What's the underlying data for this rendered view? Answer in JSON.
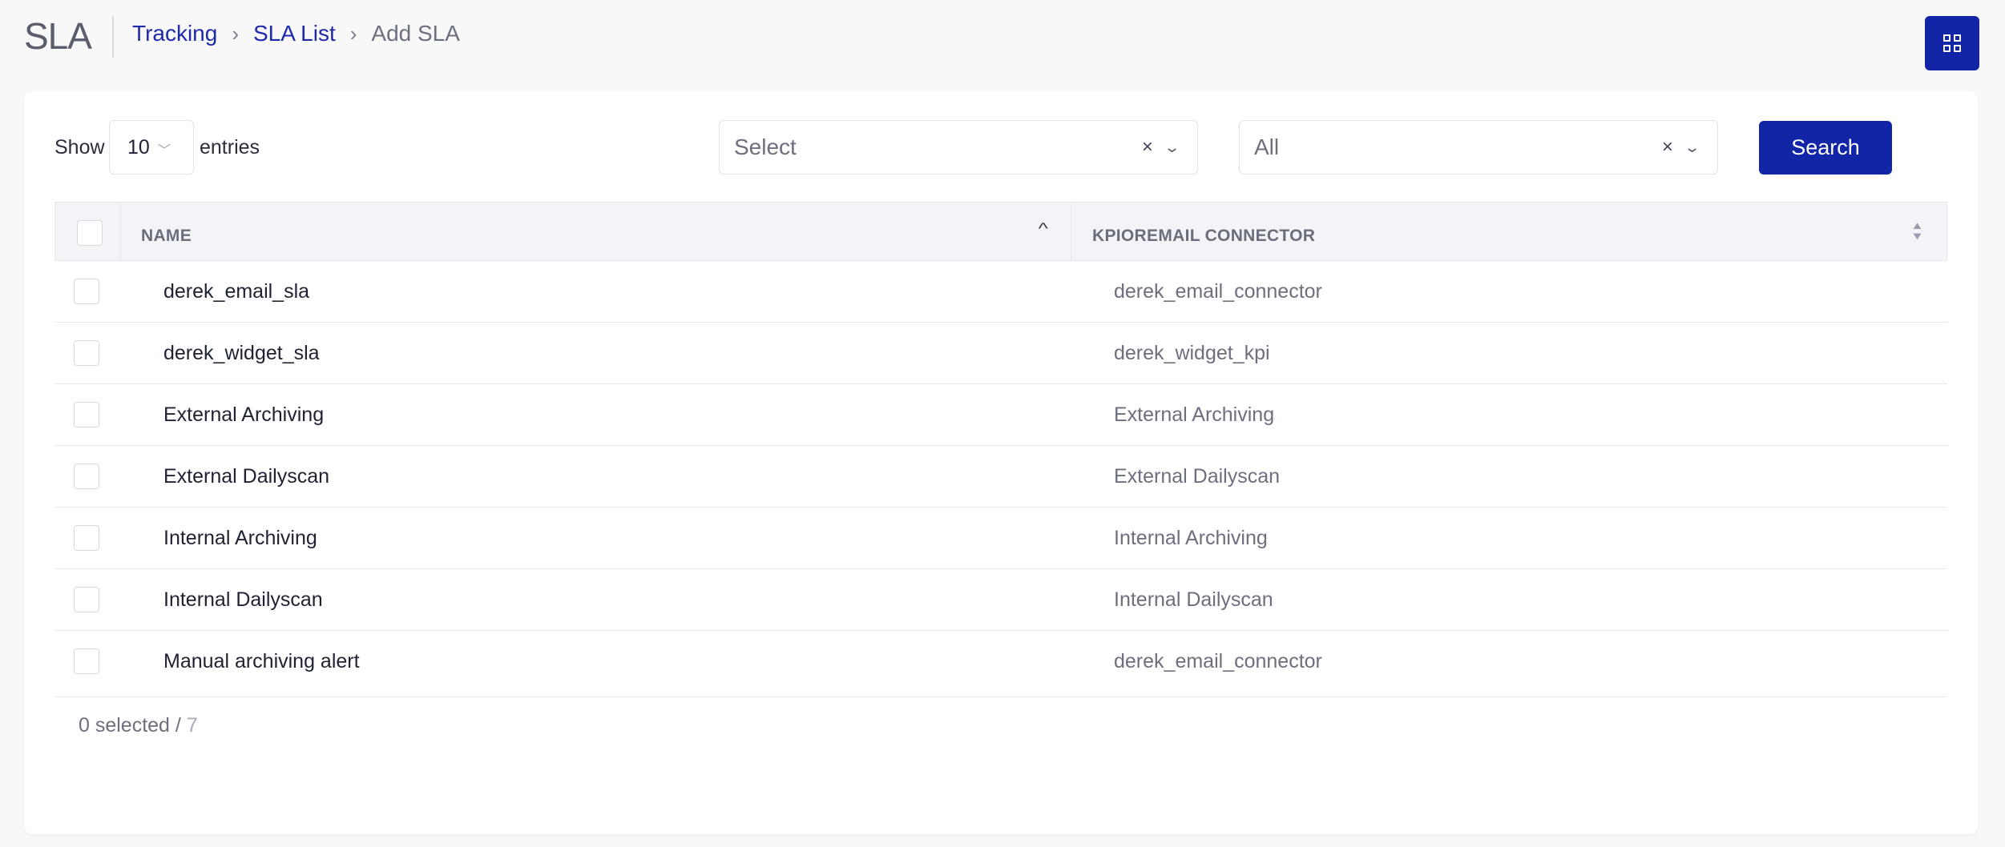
{
  "header": {
    "app_title": "SLA",
    "breadcrumb": [
      {
        "label": "Tracking"
      },
      {
        "label": "SLA List"
      },
      {
        "label": "Add SLA"
      }
    ],
    "apps_icon": "grid-icon"
  },
  "toolbar": {
    "show_label": "Show",
    "entries_value": "10",
    "entries_label": "entries",
    "filter_1": {
      "value": "Select",
      "clear": "×"
    },
    "filter_2": {
      "value": "All",
      "clear": "×"
    },
    "search_label": "Search"
  },
  "table": {
    "columns": {
      "name": "NAME",
      "kpi": "KPIOREMAIL CONNECTOR"
    },
    "rows": [
      {
        "name": "derek_email_sla",
        "kpi": "derek_email_connector"
      },
      {
        "name": "derek_widget_sla",
        "kpi": "derek_widget_kpi"
      },
      {
        "name": "External Archiving",
        "kpi": "External Archiving"
      },
      {
        "name": "External Dailyscan",
        "kpi": "External Dailyscan"
      },
      {
        "name": "Internal Archiving",
        "kpi": "Internal Archiving"
      },
      {
        "name": "Internal Dailyscan",
        "kpi": "Internal Dailyscan"
      },
      {
        "name": "Manual archiving alert",
        "kpi": "derek_email_connector"
      }
    ]
  },
  "footer": {
    "selected": "0 selected / ",
    "total": "7"
  },
  "colors": {
    "primary": "#1225a6",
    "link": "#1e2aa8",
    "background": "#f8f8f8"
  }
}
